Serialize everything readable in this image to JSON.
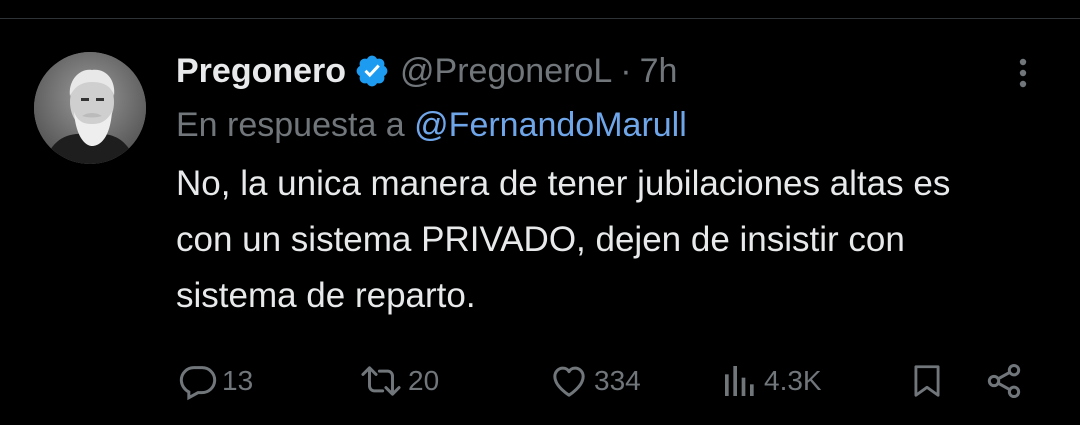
{
  "tweet": {
    "display_name": "Pregonero",
    "handle": "@PregoneroL",
    "separator": "·",
    "time": "7h",
    "reply_prefix": "En respuesta a",
    "reply_to": "@FernandoMarull",
    "text": "No, la unica manera de tener jubilaciones altas es con un sistema PRIVADO, dejen de insistir con sistema de reparto."
  },
  "actions": {
    "replies": "13",
    "retweets": "20",
    "likes": "334",
    "views": "4.3K"
  },
  "colors": {
    "background": "#000000",
    "primary_text": "#e7e9ea",
    "secondary_text": "#71767b",
    "link": "#6fa6ea",
    "verified": "#1d9bf0"
  },
  "icons": {
    "verified": "verified-badge-icon",
    "more": "more-vertical-icon",
    "reply": "reply-icon",
    "retweet": "retweet-icon",
    "like": "heart-icon",
    "views": "views-bar-chart-icon",
    "bookmark": "bookmark-icon",
    "share": "share-icon"
  }
}
